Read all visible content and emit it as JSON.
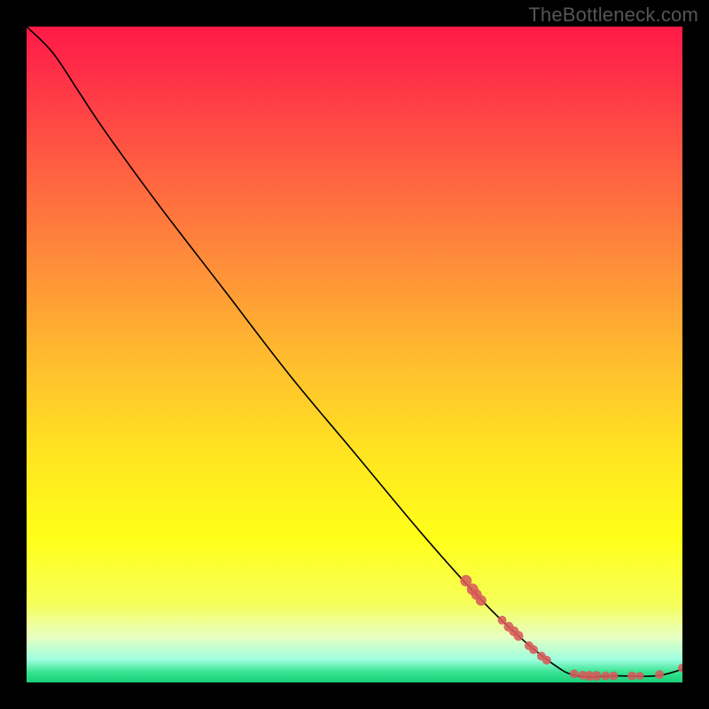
{
  "watermark": "TheBottleneck.com",
  "chart_data": {
    "type": "line",
    "title": "",
    "xlabel": "",
    "ylabel": "",
    "xlim": [
      0,
      100
    ],
    "ylim": [
      0,
      100
    ],
    "background_gradient_stops": [
      {
        "offset": 0.0,
        "color": "#ff1a47"
      },
      {
        "offset": 0.06,
        "color": "#ff2b48"
      },
      {
        "offset": 0.2,
        "color": "#ff5a42"
      },
      {
        "offset": 0.35,
        "color": "#ff8a3a"
      },
      {
        "offset": 0.5,
        "color": "#ffba2f"
      },
      {
        "offset": 0.65,
        "color": "#ffe421"
      },
      {
        "offset": 0.78,
        "color": "#ffff18"
      },
      {
        "offset": 0.88,
        "color": "#f6ff5a"
      },
      {
        "offset": 0.93,
        "color": "#e8ffc0"
      },
      {
        "offset": 0.965,
        "color": "#9effe0"
      },
      {
        "offset": 0.985,
        "color": "#35e28f"
      },
      {
        "offset": 1.0,
        "color": "#1ad07a"
      }
    ],
    "series": [
      {
        "name": "curve",
        "type": "line",
        "color": "#000000",
        "points": [
          {
            "x": 0,
            "y": 100
          },
          {
            "x": 4,
            "y": 96
          },
          {
            "x": 8,
            "y": 90
          },
          {
            "x": 12,
            "y": 84
          },
          {
            "x": 20,
            "y": 73
          },
          {
            "x": 30,
            "y": 60
          },
          {
            "x": 40,
            "y": 47
          },
          {
            "x": 50,
            "y": 35
          },
          {
            "x": 60,
            "y": 23
          },
          {
            "x": 68,
            "y": 14
          },
          {
            "x": 74,
            "y": 8
          },
          {
            "x": 80,
            "y": 3
          },
          {
            "x": 84,
            "y": 1
          },
          {
            "x": 90,
            "y": 1
          },
          {
            "x": 96,
            "y": 1
          },
          {
            "x": 100,
            "y": 2
          }
        ]
      },
      {
        "name": "markers",
        "type": "scatter",
        "color": "#d85a5a",
        "points": [
          {
            "x": 67,
            "y": 15.5,
            "r": 6.5
          },
          {
            "x": 68,
            "y": 14.2,
            "r": 6.5
          },
          {
            "x": 68.6,
            "y": 13.4,
            "r": 6.0
          },
          {
            "x": 69.3,
            "y": 12.5,
            "r": 6.0
          },
          {
            "x": 72.5,
            "y": 9.5,
            "r": 5.0
          },
          {
            "x": 73.5,
            "y": 8.5,
            "r": 5.5
          },
          {
            "x": 74.3,
            "y": 7.8,
            "r": 5.5
          },
          {
            "x": 75.0,
            "y": 7.1,
            "r": 5.5
          },
          {
            "x": 76.6,
            "y": 5.6,
            "r": 5.0
          },
          {
            "x": 77.3,
            "y": 5.0,
            "r": 5.0
          },
          {
            "x": 78.5,
            "y": 4.0,
            "r": 5.0
          },
          {
            "x": 79.3,
            "y": 3.4,
            "r": 5.0
          },
          {
            "x": 83.5,
            "y": 1.3,
            "r": 5.0
          },
          {
            "x": 84.8,
            "y": 1.1,
            "r": 5.0
          },
          {
            "x": 85.8,
            "y": 1.0,
            "r": 5.5
          },
          {
            "x": 86.9,
            "y": 1.0,
            "r": 5.5
          },
          {
            "x": 88.3,
            "y": 1.0,
            "r": 5.0
          },
          {
            "x": 89.5,
            "y": 1.0,
            "r": 5.0
          },
          {
            "x": 92.3,
            "y": 1.0,
            "r": 5.0
          },
          {
            "x": 93.5,
            "y": 1.0,
            "r": 4.5
          },
          {
            "x": 96.5,
            "y": 1.2,
            "r": 5.0
          },
          {
            "x": 100,
            "y": 2.2,
            "r": 5.0
          }
        ]
      }
    ]
  }
}
